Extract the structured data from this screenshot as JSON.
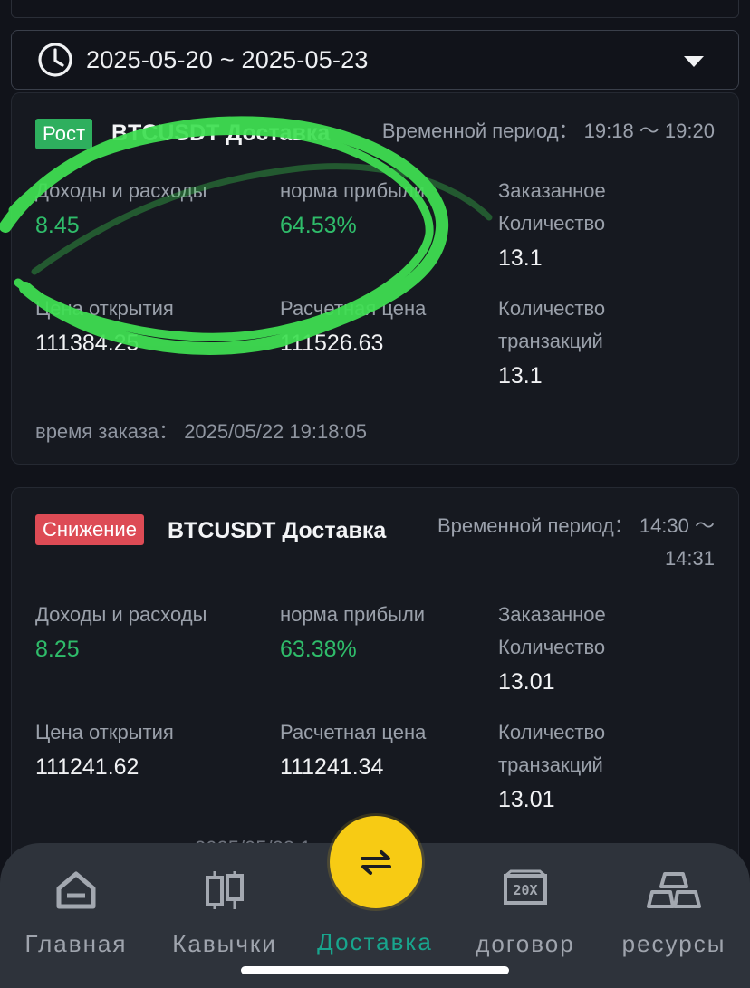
{
  "filter": {
    "date_range": "2025-05-20 ~ 2025-05-23",
    "icon": "clock-icon",
    "dropdown_icon": "caret-down-icon"
  },
  "orders": [
    {
      "badge": "Рост",
      "badge_color": "#2eaf5e",
      "title": "BTCUSDT Доставка",
      "period_label": "Временной период：",
      "period_value": "19:18 ～ 19:20",
      "income_label": "Доходы и расходы",
      "income_value": "8.45",
      "rate_label": "норма прибыли",
      "rate_value": "64.53%",
      "ordered_label_1": "Заказанное",
      "ordered_label_2": "Количество",
      "ordered_value": "13.1",
      "open_label": "Цена открытия",
      "open_value": "111384.25",
      "settle_label": "Расчетная цена",
      "settle_value": "111526.63",
      "tx_label_1": "Количество",
      "tx_label_2": "транзакций",
      "tx_value": "13.1",
      "time_label": "время заказа：",
      "time_value": "2025/05/22 19:18:05"
    },
    {
      "badge": "Снижение",
      "badge_color": "#dd4b55",
      "title": "BTCUSDT Доставка",
      "period_label": "Временной период：",
      "period_value_1": "14:30 ～",
      "period_value_2": "14:31",
      "income_label": "Доходы и расходы",
      "income_value": "8.25",
      "rate_label": "норма прибыли",
      "rate_value": "63.38%",
      "ordered_label_1": "Заказанное",
      "ordered_label_2": "Количество",
      "ordered_value": "13.01",
      "open_label": "Цена открытия",
      "open_value": "111241.62",
      "settle_label": "Расчетная цена",
      "settle_value": "111241.34",
      "tx_label_1": "Количество",
      "tx_label_2": "транзакций",
      "tx_value": "13.01",
      "time_partial": "2025/05/23 1"
    }
  ],
  "nav": {
    "items": [
      {
        "label": "Главная",
        "icon": "home-icon"
      },
      {
        "label": "Кавычки",
        "icon": "candlestick-icon"
      },
      {
        "label": "Доставка",
        "icon": "swap-arrows-icon",
        "active": true
      },
      {
        "label": "договор",
        "icon": "leverage-20x-icon"
      },
      {
        "label": "ресурсы",
        "icon": "gold-bars-icon"
      }
    ]
  },
  "colors": {
    "background": "#11131a",
    "card": "#161920",
    "positive": "#2fbc6a",
    "accent_fab": "#f7cb14",
    "active_nav": "#18a58d",
    "scribble": "#3fe052"
  }
}
